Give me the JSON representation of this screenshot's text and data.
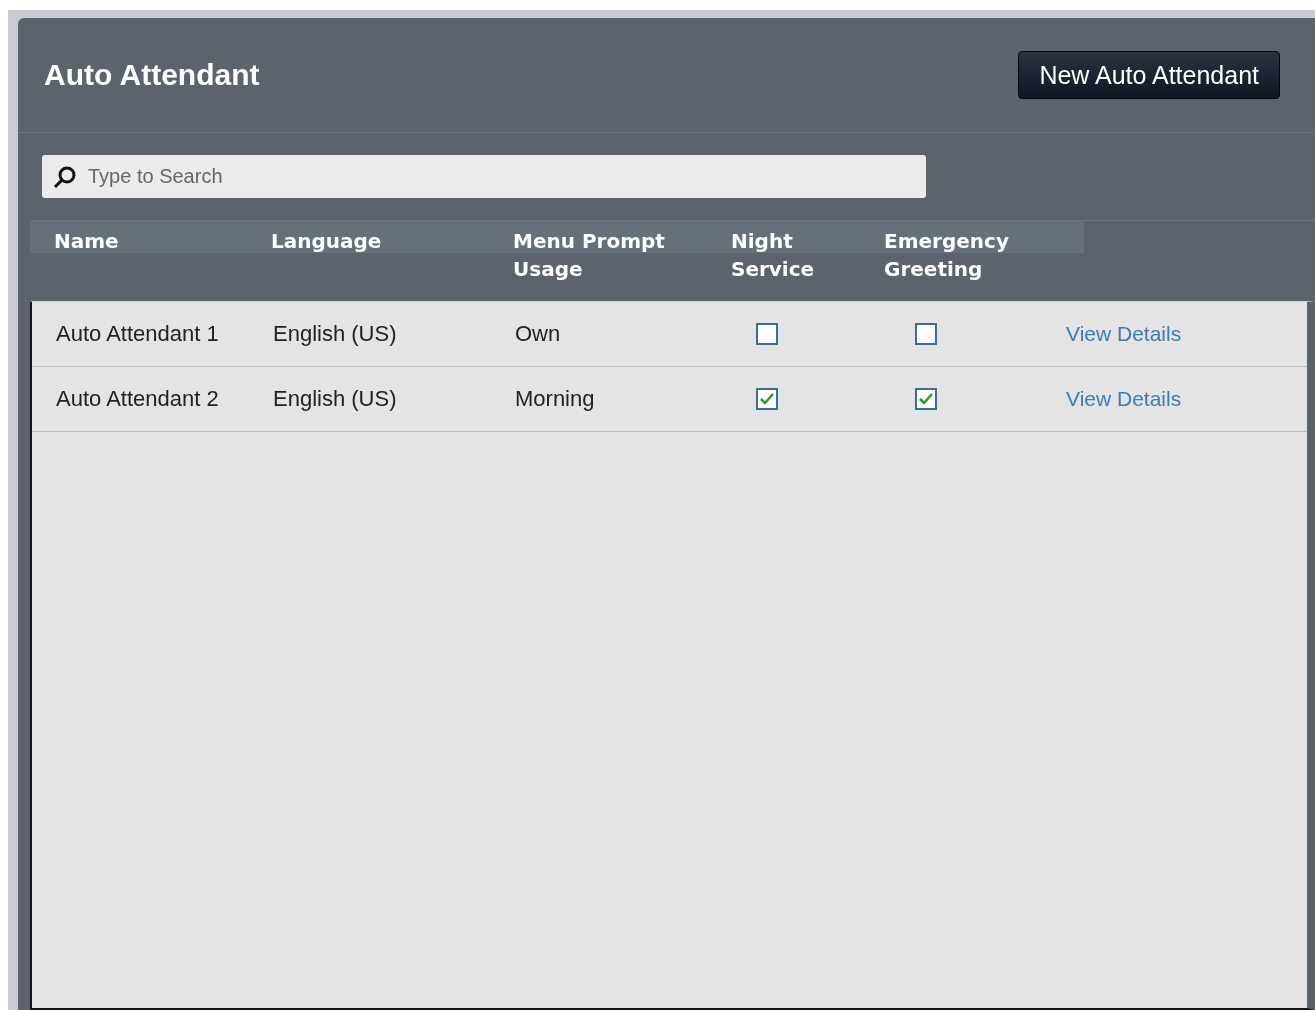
{
  "title": "Auto Attendant",
  "new_button": "New Auto Attendant",
  "search": {
    "placeholder": "Type to Search"
  },
  "table": {
    "columns": [
      "Name",
      "Language",
      "Menu Prompt Usage",
      "Night Service",
      "Emergency Greeting"
    ],
    "rows": [
      {
        "name": "Auto Attendant 1",
        "language": "English (US)",
        "menu_prompt_usage": "Own",
        "night_service": false,
        "emergency_greeting": false,
        "link": "View Details"
      },
      {
        "name": "Auto Attendant 2",
        "language": "English (US)",
        "menu_prompt_usage": "Morning",
        "night_service": true,
        "emergency_greeting": true,
        "link": "View Details"
      }
    ]
  }
}
